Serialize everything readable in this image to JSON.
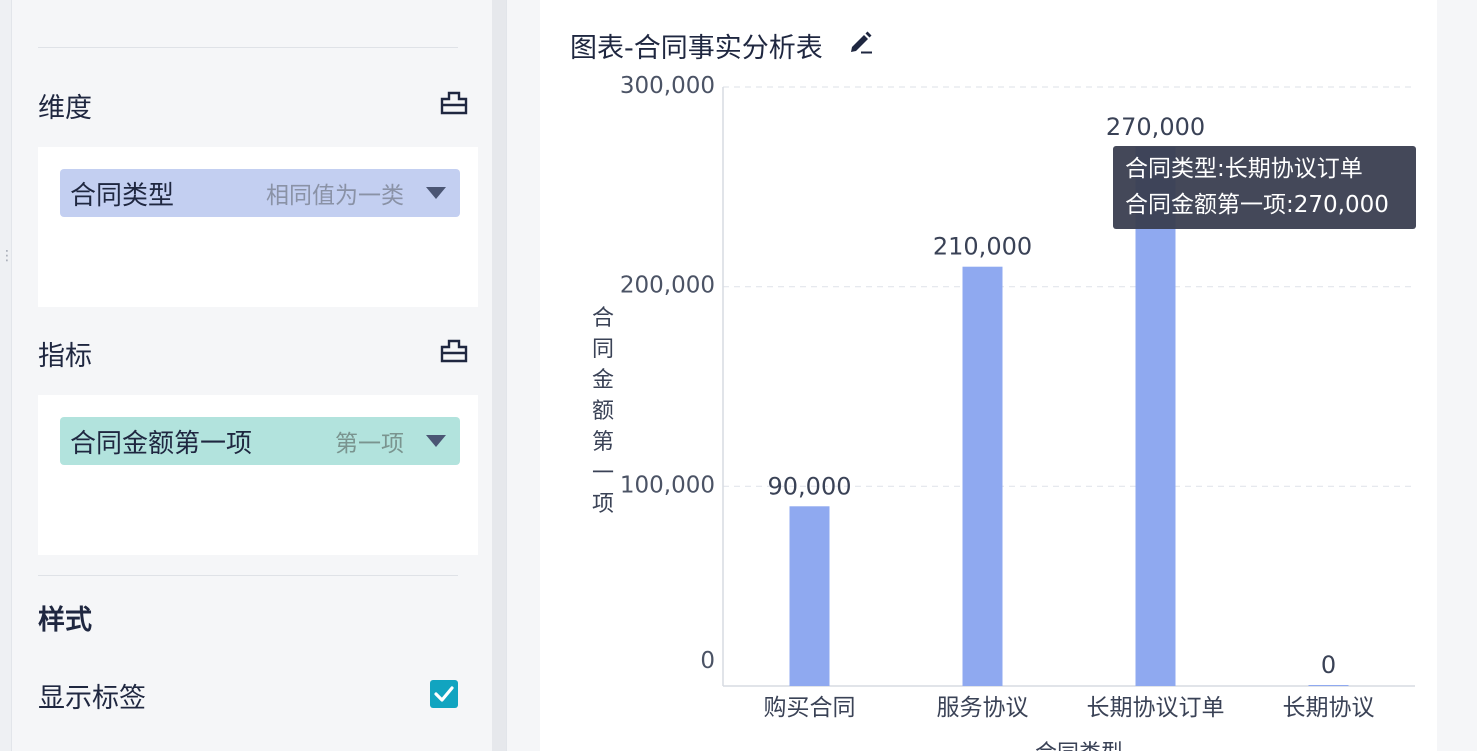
{
  "sidebar": {
    "dimension_title": "维度",
    "dimension_field": {
      "name": "合同类型",
      "hint": "相同值为一类"
    },
    "measure_title": "指标",
    "measure_field": {
      "name": "合同金额第一项",
      "hint": "第一项"
    },
    "style_title": "样式",
    "show_labels_label": "显示标签",
    "show_labels_checked": true,
    "icons": {
      "settings": "settings-icon",
      "caret": "chevron-down-icon",
      "check": "checkbox-check-icon"
    }
  },
  "chart_title": "图表-合同事实分析表",
  "chart_data": {
    "type": "bar",
    "categories": [
      "购买合同",
      "服务协议",
      "长期协议订单",
      "长期协议"
    ],
    "values": [
      90000,
      210000,
      270000,
      0
    ],
    "data_labels": [
      "90,000",
      "210,000",
      "270,000",
      "0"
    ],
    "ylabel": "合同金额第一项",
    "xlabel": "合同类型",
    "ylim": [
      0,
      300000
    ],
    "yticks": [
      0,
      100000,
      200000,
      300000
    ],
    "ytick_labels": [
      "0",
      "100,000",
      "200,000",
      "300,000"
    ],
    "grid": true,
    "bar_color": "#8fa9f0"
  },
  "tooltip": {
    "line1": "合同类型:长期协议订单",
    "line2": "合同金额第一项:270,000"
  },
  "colors": {
    "accent": "#11a4c0",
    "dimension_pill": "#c3cff1",
    "measure_pill": "#b2e3dd"
  }
}
